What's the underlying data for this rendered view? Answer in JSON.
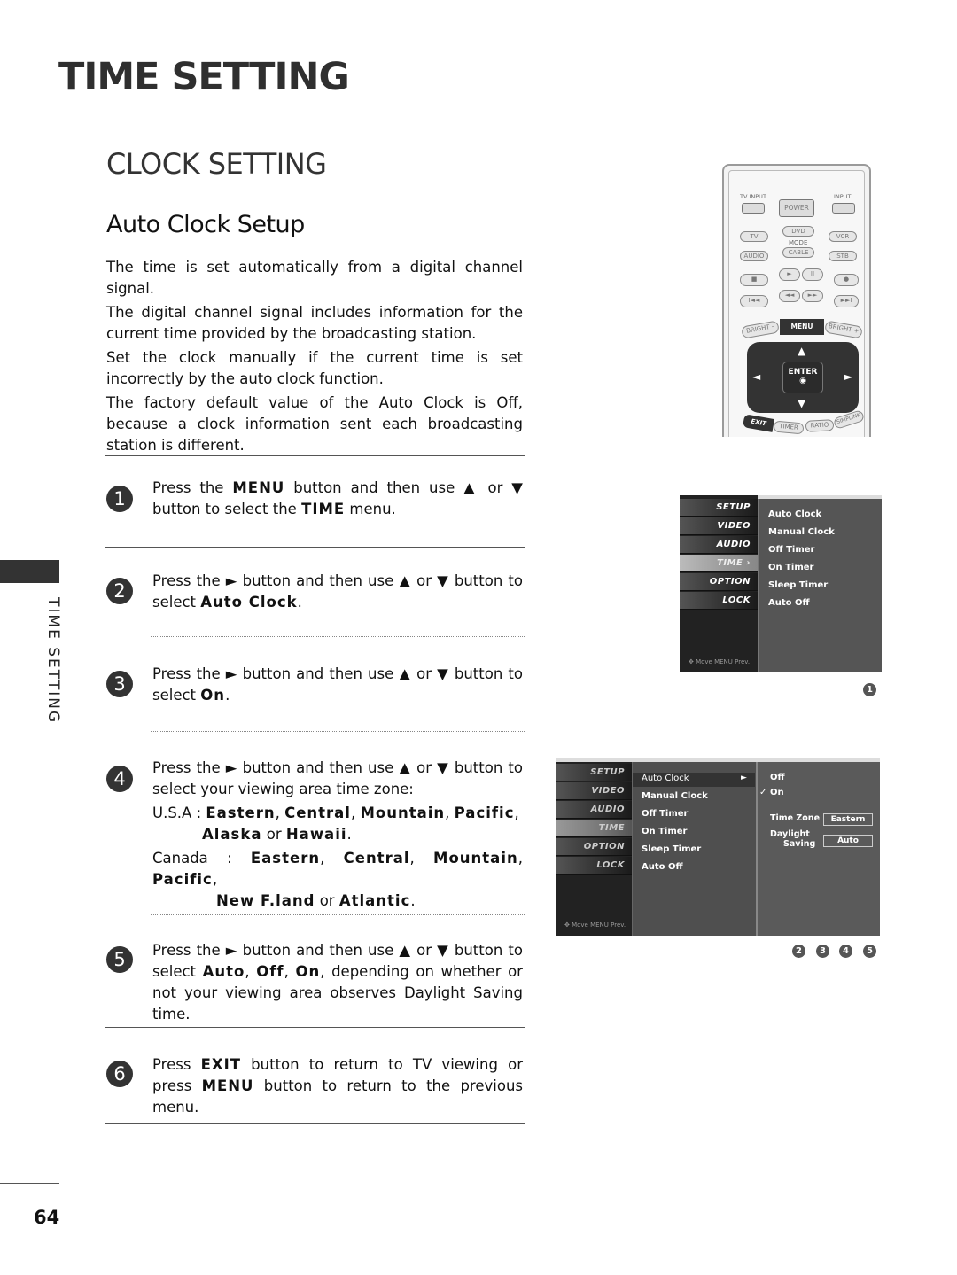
{
  "page": {
    "title": "TIME SETTING",
    "section_title": "CLOCK SETTING",
    "subsection_title": "Auto Clock Setup",
    "side_label": "TIME SETTING",
    "page_number": "64"
  },
  "intro": [
    "The time is set automatically from a digital channel signal.",
    "The digital channel signal includes information for the current time provided by the broadcasting station.",
    "Set the clock manually if the current time is set incorrectly by the auto clock function.",
    "The factory default value of the Auto Clock is Off, because a clock information sent each broadcasting station is different."
  ],
  "steps": [
    {
      "num": "1",
      "pre": "Press the ",
      "k1": "MENU",
      "mid": " button and then use ▲ or ▼ button to select the ",
      "k2": "TIME",
      "post": " menu."
    },
    {
      "num": "2",
      "pre": "Press the ► button and then use ▲ or ▼ button to select ",
      "k1": "Auto Clock",
      "post": "."
    },
    {
      "num": "3",
      "pre": "Press the ► button and then use ▲ or ▼ button to select ",
      "k1": "On",
      "post": "."
    },
    {
      "num": "4",
      "pre": "Press the ► button and then use ▲ or ▼ button to select your viewing area time zone:",
      "usa_label": "U.S.A : ",
      "usa": [
        "Eastern",
        "Central",
        "Mountain",
        "Pacific",
        "Alaska",
        "Hawaii"
      ],
      "canada_label": "Canada : ",
      "canada": [
        "Eastern",
        "Central",
        "Mountain",
        "Pacific",
        "New F.land",
        "Atlantic"
      ],
      "sep": ", ",
      "or": " or ",
      "end": "."
    },
    {
      "num": "5",
      "pre": "Press the ► button and then use ▲ or ▼ button to select ",
      "k1": "Auto",
      "k2": "Off",
      "k3": "On",
      "post": ", depending on whether or not your viewing area observes Daylight Saving time."
    },
    {
      "num": "6",
      "pre": "Press ",
      "k1": "EXIT",
      "mid": " button to return to TV viewing or press ",
      "k2": "MENU",
      "post": " button to return to the previous menu."
    }
  ],
  "remote": {
    "tv_input": "TV INPUT",
    "input": "INPUT",
    "power": "POWER",
    "mode_label": "MODE",
    "modes": [
      "TV",
      "DVD",
      "VCR",
      "AUDIO",
      "CABLE",
      "STB"
    ],
    "transport": [
      "■",
      "►",
      "II",
      "●",
      "I◄◄",
      "◄◄",
      "►►",
      "►►I"
    ],
    "menu": "MENU",
    "bright_minus": "BRIGHT -",
    "bright_plus": "BRIGHT +",
    "enter": "ENTER",
    "exit": "EXIT",
    "timer": "TIMER",
    "ratio": "RATIO",
    "simplink": "SIMPLINK"
  },
  "osd1": {
    "tabs": [
      "SETUP",
      "VIDEO",
      "AUDIO",
      "TIME ›",
      "OPTION",
      "LOCK"
    ],
    "active_tab": 3,
    "footer": "✥ Move   MENU Prev.",
    "items": [
      "Auto Clock",
      "Manual Clock",
      "Off Timer",
      "On Timer",
      "Sleep Timer",
      "Auto Off"
    ],
    "badge": "1"
  },
  "osd2": {
    "tabs": [
      "SETUP",
      "VIDEO",
      "AUDIO",
      "TIME",
      "OPTION",
      "LOCK"
    ],
    "footer": "✥ Move   MENU Prev.",
    "items": [
      "Auto Clock",
      "Manual Clock",
      "Off Timer",
      "On Timer",
      "Sleep Timer",
      "Auto Off"
    ],
    "selected_arrow": "►",
    "options": [
      "Off",
      "On"
    ],
    "check": "✓",
    "time_zone_label": "Time Zone",
    "time_zone_value": "Eastern",
    "daylight_label_1": "Daylight",
    "daylight_label_2": "Saving",
    "daylight_value": "Auto",
    "badges": [
      "2",
      "3",
      "4",
      "5"
    ]
  }
}
